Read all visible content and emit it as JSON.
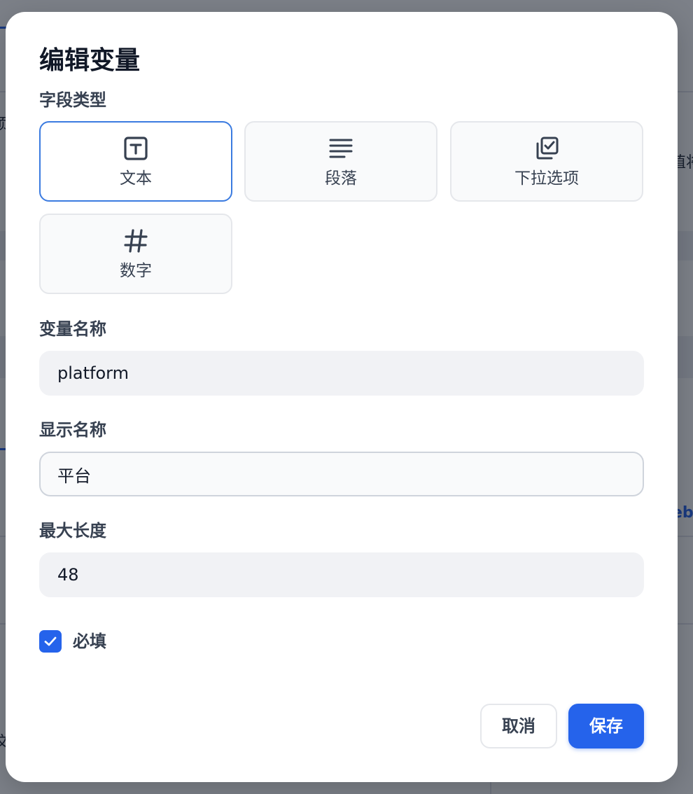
{
  "background": {
    "fragments": [
      "项",
      "值将",
      "eb",
      "文"
    ]
  },
  "dialog": {
    "title": "编辑变量",
    "field_type": {
      "label": "字段类型",
      "options": [
        {
          "label": "文本",
          "icon": "text-box-icon",
          "selected": true
        },
        {
          "label": "段落",
          "icon": "paragraph-lines-icon",
          "selected": false
        },
        {
          "label": "下拉选项",
          "icon": "dropdown-copy-check-icon",
          "selected": false
        },
        {
          "label": "数字",
          "icon": "hash-icon",
          "selected": false
        }
      ]
    },
    "variable_name": {
      "label": "变量名称",
      "value": "platform"
    },
    "display_name": {
      "label": "显示名称",
      "value": "平台"
    },
    "max_length": {
      "label": "最大长度",
      "value": "48"
    },
    "required": {
      "label": "必填",
      "checked": true
    },
    "buttons": {
      "cancel": "取消",
      "save": "保存"
    }
  },
  "colors": {
    "primary": "#2563eb",
    "selected_border": "#3b7be0",
    "overlay": "#6b717b"
  }
}
